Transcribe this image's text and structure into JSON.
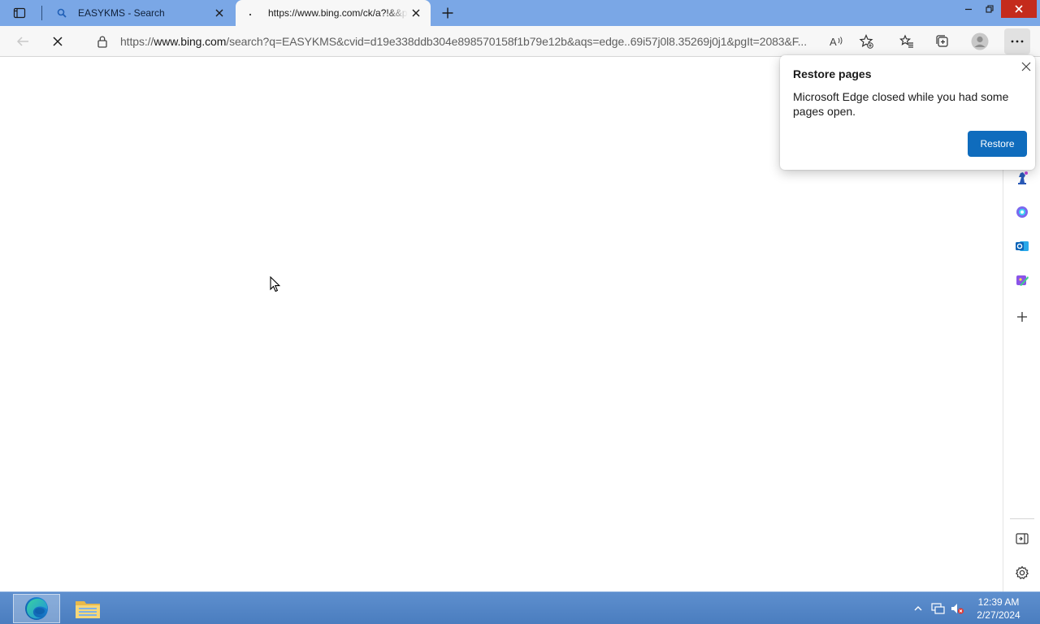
{
  "tabs": [
    {
      "title": "EASYKMS - Search",
      "active": false
    },
    {
      "title": "https://www.bing.com/ck/a?!&&p=",
      "active": true
    }
  ],
  "address_bar": {
    "url_prefix": "https://",
    "url_host": "www.bing.com",
    "url_path": "/search?q=EASYKMS&cvid=d19e338ddb304e898570158f1b79e12b&aqs=edge..69i57j0l8.35269j0j1&pgIt=2083&F..."
  },
  "popup": {
    "title": "Restore pages",
    "message": "Microsoft Edge closed while you had some pages open.",
    "button": "Restore"
  },
  "taskbar": {
    "time": "12:39 AM",
    "date": "2/27/2024"
  },
  "colors": {
    "tabstrip": "#7aa7e6",
    "accent": "#0f6cbd",
    "close_button": "#c42b1c"
  },
  "icons": [
    "tab-actions-icon",
    "search-icon",
    "close-icon",
    "loading-icon",
    "new-tab-icon",
    "minimize-icon",
    "maximize-icon",
    "window-close-icon",
    "back-icon",
    "stop-icon",
    "lock-icon",
    "read-aloud-icon",
    "add-favorite-icon",
    "favorites-icon",
    "collections-icon",
    "profile-icon",
    "more-icon",
    "chess-icon",
    "copilot-icon",
    "outlook-icon",
    "designer-icon",
    "add-icon",
    "hide-sidebar-icon",
    "settings-icon",
    "edge-icon",
    "file-explorer-icon"
  ]
}
